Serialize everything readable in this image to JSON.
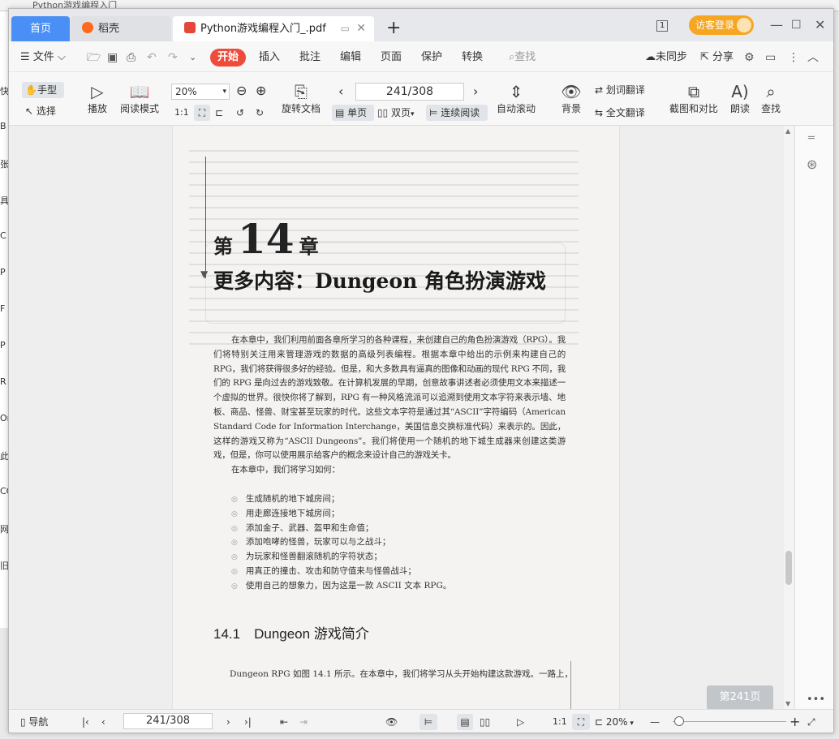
{
  "background": {
    "title_fragment": "Python游戏编程入门",
    "left_fragments": [
      "快",
      "B",
      "张",
      "具",
      "C",
      "P",
      "F",
      "P",
      "R",
      "On",
      "此",
      "CO",
      "网",
      "旧"
    ]
  },
  "tabs": {
    "home": "首页",
    "daoke": "稻壳",
    "pdf": "Python游戏编程入门_.pdf",
    "add": "+"
  },
  "titlebar": {
    "login": "访客登录",
    "badge": "1"
  },
  "menu": {
    "file": "文件",
    "start": "开始",
    "insert": "插入",
    "comment": "批注",
    "edit": "编辑",
    "page": "页面",
    "protect": "保护",
    "convert": "转换",
    "search": "查找",
    "unsynced": "未同步",
    "share": "分享"
  },
  "toolbar": {
    "hand": "手型",
    "select": "选择",
    "play": "播放",
    "read_mode": "阅读模式",
    "zoom": "20%",
    "rotate": "旋转文档",
    "page_value": "241/308",
    "single": "单页",
    "double": "双页",
    "continuous": "连续阅读",
    "auto_scroll": "自动滚动",
    "background": "背景",
    "word_translate": "划词翻译",
    "full_translate": "全文翻译",
    "screenshot_compare": "截图和对比",
    "read_aloud": "朗读",
    "find": "查找"
  },
  "document": {
    "chapter_prefix": "第",
    "chapter_number": "14",
    "chapter_suffix": "章",
    "chapter_title": "更多内容：Dungeon 角色扮演游戏",
    "paragraph": "在本章中，我们利用前面各章所学习的各种课程，来创建自己的角色扮演游戏（RPG）。我们将特别关注用来管理游戏的数据的高级列表编程。根据本章中给出的示例来构建自己的 RPG，我们将获得很多好的经验。但是，和大多数具有逼真的图像和动画的现代 RPG 不同，我们的 RPG 是向过去的游戏致敬。在计算机发展的早期，创意故事讲述者必须使用文本来描述一个虚拟的世界。很快你将了解到，RPG 有一种风格流派可以追溯到使用文本字符来表示墙、地板、商品、怪兽、财宝甚至玩家的时代。这些文本字符是通过其“ASCII”字符编码（American Standard Code for Information Interchange，美国信息交换标准代码）来表示的。因此，这样的游戏又称为“ASCII Dungeons”。我们将使用一个随机的地下城生成器来创建这类游戏，但是，你可以使用展示给客户的概念来设计自己的游戏关卡。",
    "learn_intro": "在本章中，我们将学习如何：",
    "list": [
      "生成随机的地下城房间；",
      "用走廊连接地下城房间；",
      "添加金子、武器、盔甲和生命值；",
      "添加咆哮的怪兽，玩家可以与之战斗；",
      "为玩家和怪兽翻滚随机的字符状态；",
      "用真正的撞击、攻击和防守值来与怪兽战斗；",
      "使用自己的想象力，因为这是一款 ASCII 文本 RPG。"
    ],
    "section": "14.1　Dungeon 游戏简介",
    "last_line": "Dungeon RPG 如图 14.1 所示。在本章中，我们将学习从头开始构建这款游戏。一路上，"
  },
  "viewer": {
    "page_badge": "第241页"
  },
  "status": {
    "nav": "导航",
    "page_value": "241/308",
    "zoom": "20%"
  }
}
